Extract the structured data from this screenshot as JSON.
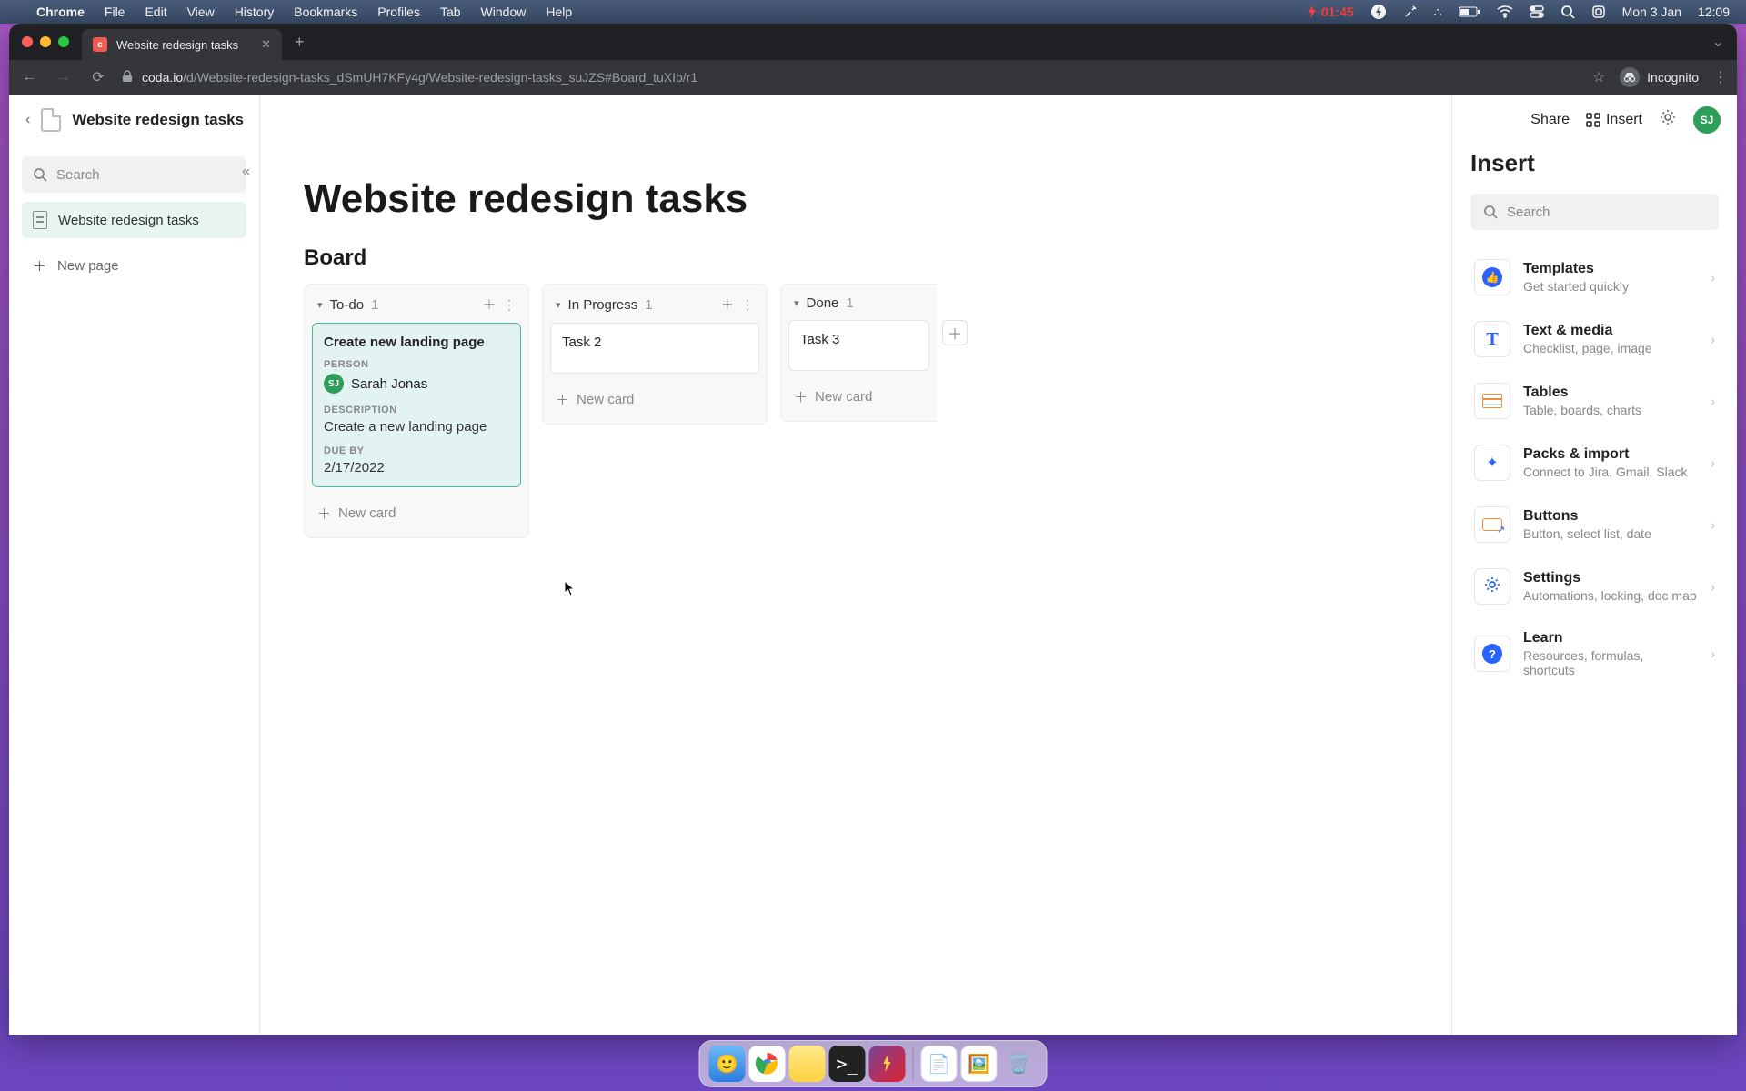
{
  "mac": {
    "app": "Chrome",
    "menus": [
      "File",
      "Edit",
      "View",
      "History",
      "Bookmarks",
      "Profiles",
      "Tab",
      "Window",
      "Help"
    ],
    "batt": "01:45",
    "date": "Mon 3 Jan",
    "time": "12:09"
  },
  "browser": {
    "tab_title": "Website redesign tasks",
    "url_host": "coda.io",
    "url_path": "/d/Website-redesign-tasks_dSmUH7KFy4g/Website-redesign-tasks_suJZS#Board_tuXIb/r1",
    "incognito": "Incognito"
  },
  "doc_title": "Website redesign tasks",
  "toolbar": {
    "share": "Share",
    "insert": "Insert"
  },
  "avatar": "SJ",
  "sidebar": {
    "search_placeholder": "Search",
    "pages": [
      {
        "label": "Website redesign tasks"
      }
    ],
    "new_page": "New page"
  },
  "page": {
    "title": "Website redesign tasks",
    "board_label": "Board"
  },
  "board": {
    "columns": [
      {
        "name": "To-do",
        "count": "1",
        "cards": [
          {
            "title": "Create new landing page",
            "selected": true,
            "fields": {
              "person_label": "PERSON",
              "person_name": "Sarah Jonas",
              "person_initials": "SJ",
              "desc_label": "DESCRIPTION",
              "desc": "Create a new landing page",
              "due_label": "DUE BY",
              "due": "2/17/2022"
            }
          }
        ]
      },
      {
        "name": "In Progress",
        "count": "1",
        "cards": [
          {
            "title": "Task 2"
          }
        ]
      },
      {
        "name": "Done",
        "count": "1",
        "cards": [
          {
            "title": "Task 3"
          }
        ],
        "partial": true
      }
    ],
    "new_card": "New card"
  },
  "insert": {
    "title": "Insert",
    "search_placeholder": "Search",
    "items": [
      {
        "title": "Templates",
        "sub": "Get started quickly",
        "icon": "thumb"
      },
      {
        "title": "Text & media",
        "sub": "Checklist, page, image",
        "icon": "T"
      },
      {
        "title": "Tables",
        "sub": "Table, boards, charts",
        "icon": "table"
      },
      {
        "title": "Packs & import",
        "sub": "Connect to Jira, Gmail, Slack",
        "icon": "pack"
      },
      {
        "title": "Buttons",
        "sub": "Button, select list, date",
        "icon": "btn"
      },
      {
        "title": "Settings",
        "sub": "Automations, locking, doc map",
        "icon": "gear"
      },
      {
        "title": "Learn",
        "sub": "Resources, formulas, shortcuts",
        "icon": "q"
      }
    ]
  }
}
